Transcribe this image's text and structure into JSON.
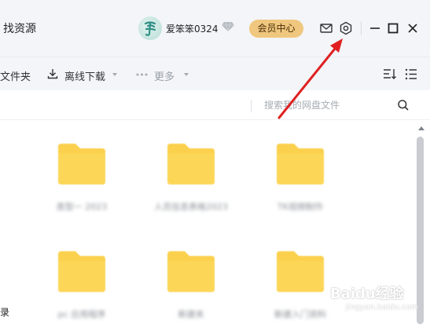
{
  "titlebar": {
    "nav_label": "找资源",
    "username": "爱笨笨0324",
    "vip_button": "会员中心"
  },
  "toolbar": {
    "new_folder_partial": "文件夹",
    "offline_download": "离线下载",
    "more": "更多"
  },
  "search": {
    "placeholder": "搜索我的网盘文件"
  },
  "folders": [
    {
      "name": "类型一 2023"
    },
    {
      "name": "人员信息表格2023"
    },
    {
      "name": "TK视频制作"
    },
    {
      "name": "pc 应用程序"
    },
    {
      "name": "新建夹"
    },
    {
      "name": "新建入门资料"
    }
  ],
  "sidebar": {
    "partial_label": "录"
  },
  "watermark": {
    "main": "Baidu经验",
    "sub": "jingyan.baidu.com"
  },
  "colors": {
    "titlebar_bg": "#f3f5f9",
    "vip_gold": "#f0c77e",
    "folder_yellow": "#fbd04d",
    "annotation_red": "#e02020"
  }
}
